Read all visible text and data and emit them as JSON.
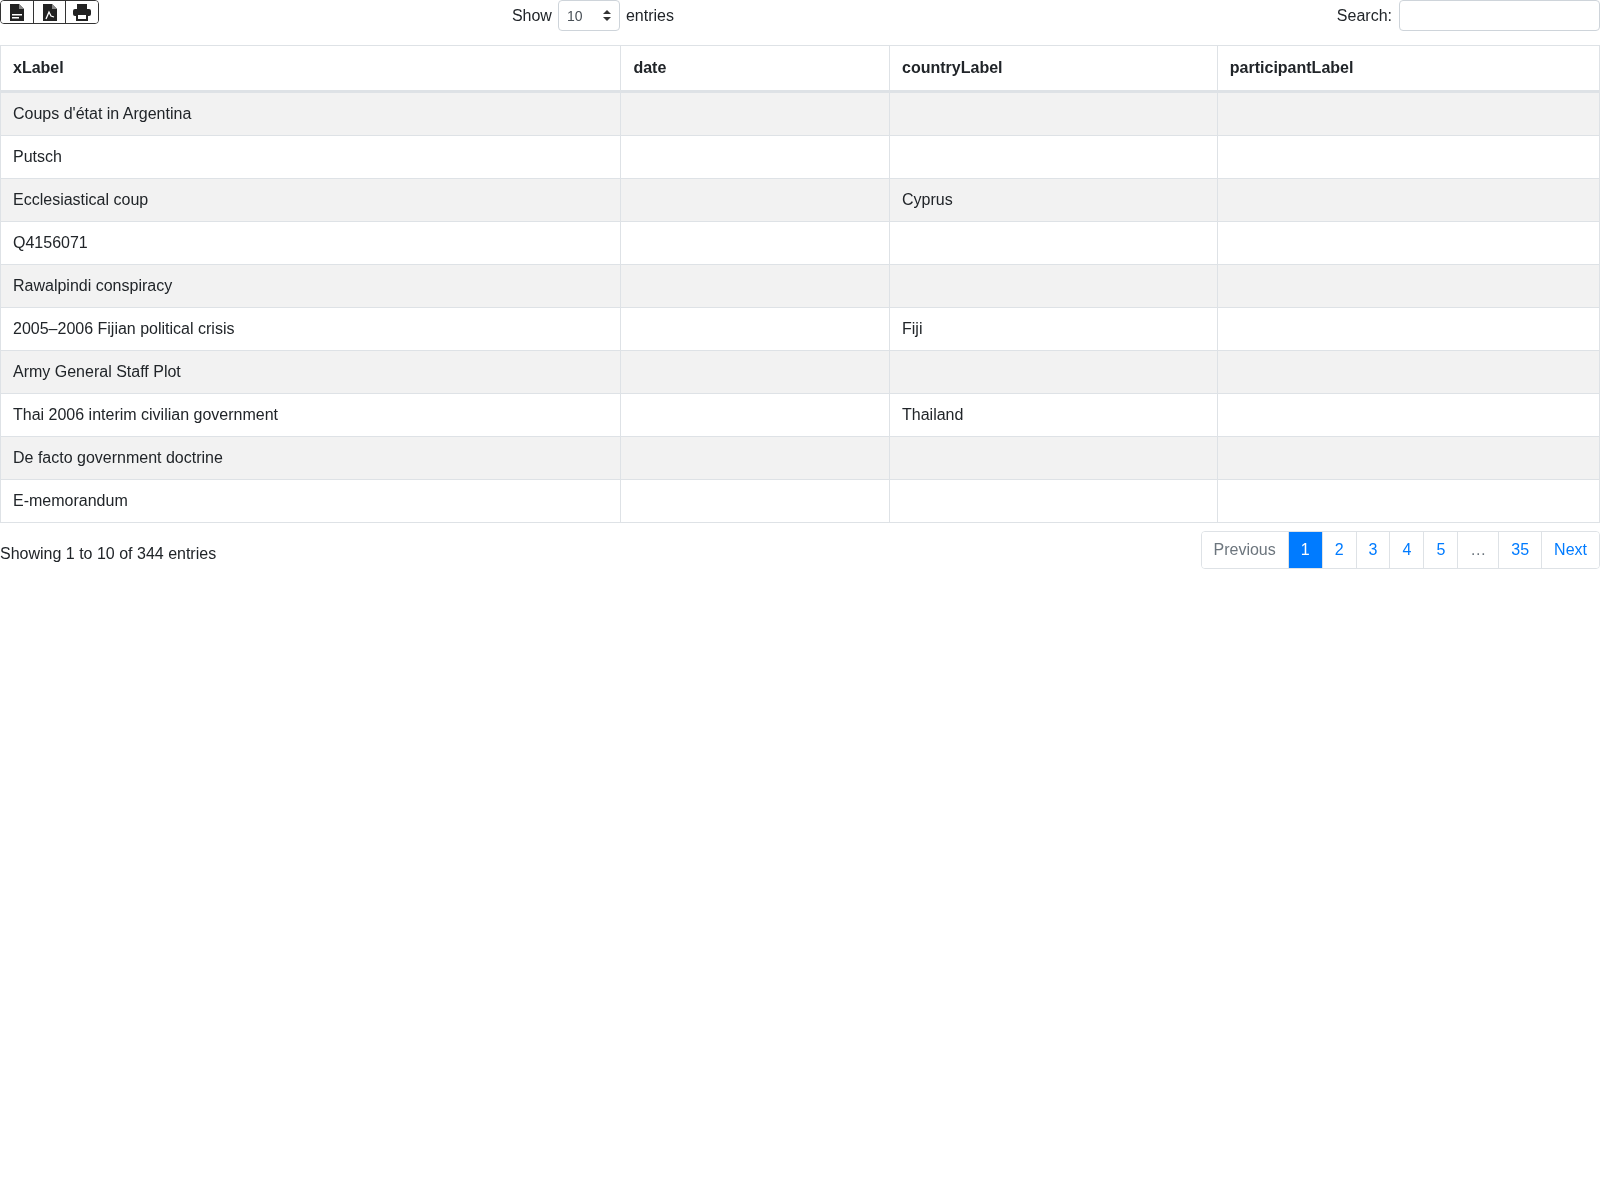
{
  "toolbar": {
    "buttons": [
      {
        "kind": "csv"
      },
      {
        "kind": "pdf"
      },
      {
        "kind": "print"
      }
    ]
  },
  "length": {
    "before": "Show",
    "value": "10",
    "after": "entries"
  },
  "search": {
    "label": "Search:"
  },
  "table": {
    "columns": [
      "xLabel",
      "date",
      "countryLabel",
      "participantLabel"
    ],
    "rows": [
      [
        "Coups d'état in Argentina",
        "",
        "",
        ""
      ],
      [
        "Putsch",
        "",
        "",
        ""
      ],
      [
        "Ecclesiastical coup",
        "",
        "Cyprus",
        ""
      ],
      [
        "Q4156071",
        "",
        "",
        ""
      ],
      [
        "Rawalpindi conspiracy",
        "",
        "",
        ""
      ],
      [
        "2005–2006 Fijian political crisis",
        "",
        "Fiji",
        ""
      ],
      [
        "Army General Staff Plot",
        "",
        "",
        ""
      ],
      [
        "Thai 2006 interim civilian government",
        "",
        "Thailand",
        ""
      ],
      [
        "De facto government doctrine",
        "",
        "",
        ""
      ],
      [
        "E-memorandum",
        "",
        "",
        ""
      ]
    ]
  },
  "info": "Showing 1 to 10 of 344 entries",
  "pagination": [
    {
      "label": "Previous",
      "selected": false,
      "disabled": true
    },
    {
      "label": "1",
      "selected": true,
      "disabled": false
    },
    {
      "label": "2",
      "selected": false,
      "disabled": false
    },
    {
      "label": "3",
      "selected": false,
      "disabled": false
    },
    {
      "label": "4",
      "selected": false,
      "disabled": false
    },
    {
      "label": "5",
      "selected": false,
      "disabled": false
    },
    {
      "label": "…",
      "selected": false,
      "disabled": true
    },
    {
      "label": "35",
      "selected": false,
      "disabled": false
    },
    {
      "label": "Next",
      "selected": false,
      "disabled": false
    }
  ]
}
